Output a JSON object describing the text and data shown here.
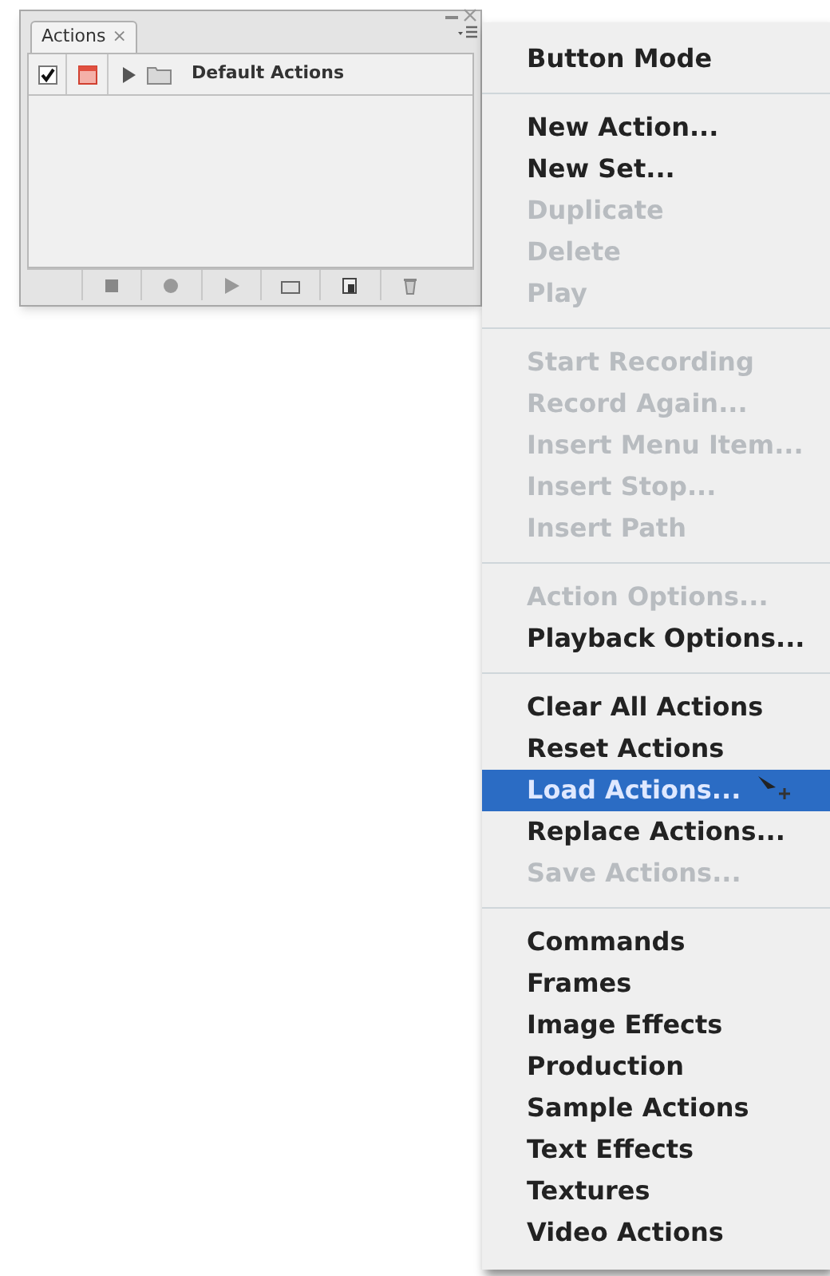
{
  "panel": {
    "tab": {
      "label": "Actions",
      "close": "×",
      "selected": true
    },
    "action_sets": [
      {
        "name": "Default Actions",
        "checked": true,
        "dialog": true,
        "expanded": false
      }
    ]
  },
  "menu": {
    "groups": [
      [
        {
          "label": "Button Mode",
          "disabled": false,
          "selected": false
        }
      ],
      [
        {
          "label": "New Action...",
          "disabled": false,
          "selected": false
        },
        {
          "label": "New Set...",
          "disabled": false,
          "selected": false
        },
        {
          "label": "Duplicate",
          "disabled": true,
          "selected": false
        },
        {
          "label": "Delete",
          "disabled": true,
          "selected": false
        },
        {
          "label": "Play",
          "disabled": true,
          "selected": false
        }
      ],
      [
        {
          "label": "Start Recording",
          "disabled": true,
          "selected": false
        },
        {
          "label": "Record Again...",
          "disabled": true,
          "selected": false
        },
        {
          "label": "Insert Menu Item...",
          "disabled": true,
          "selected": false
        },
        {
          "label": "Insert Stop...",
          "disabled": true,
          "selected": false
        },
        {
          "label": "Insert Path",
          "disabled": true,
          "selected": false
        }
      ],
      [
        {
          "label": "Action Options...",
          "disabled": true,
          "selected": false
        },
        {
          "label": "Playback Options...",
          "disabled": false,
          "selected": false
        }
      ],
      [
        {
          "label": "Clear All Actions",
          "disabled": false,
          "selected": false
        },
        {
          "label": "Reset Actions",
          "disabled": false,
          "selected": false
        },
        {
          "label": "Load Actions...",
          "disabled": false,
          "selected": true
        },
        {
          "label": "Replace Actions...",
          "disabled": false,
          "selected": false
        },
        {
          "label": "Save Actions...",
          "disabled": true,
          "selected": false
        }
      ],
      [
        {
          "label": "Commands",
          "disabled": false,
          "selected": false
        },
        {
          "label": "Frames",
          "disabled": false,
          "selected": false
        },
        {
          "label": "Image Effects",
          "disabled": false,
          "selected": false
        },
        {
          "label": "Production",
          "disabled": false,
          "selected": false
        },
        {
          "label": "Sample Actions",
          "disabled": false,
          "selected": false
        },
        {
          "label": "Text Effects",
          "disabled": false,
          "selected": false
        },
        {
          "label": "Textures",
          "disabled": false,
          "selected": false
        },
        {
          "label": "Video Actions",
          "disabled": false,
          "selected": false
        }
      ]
    ]
  }
}
